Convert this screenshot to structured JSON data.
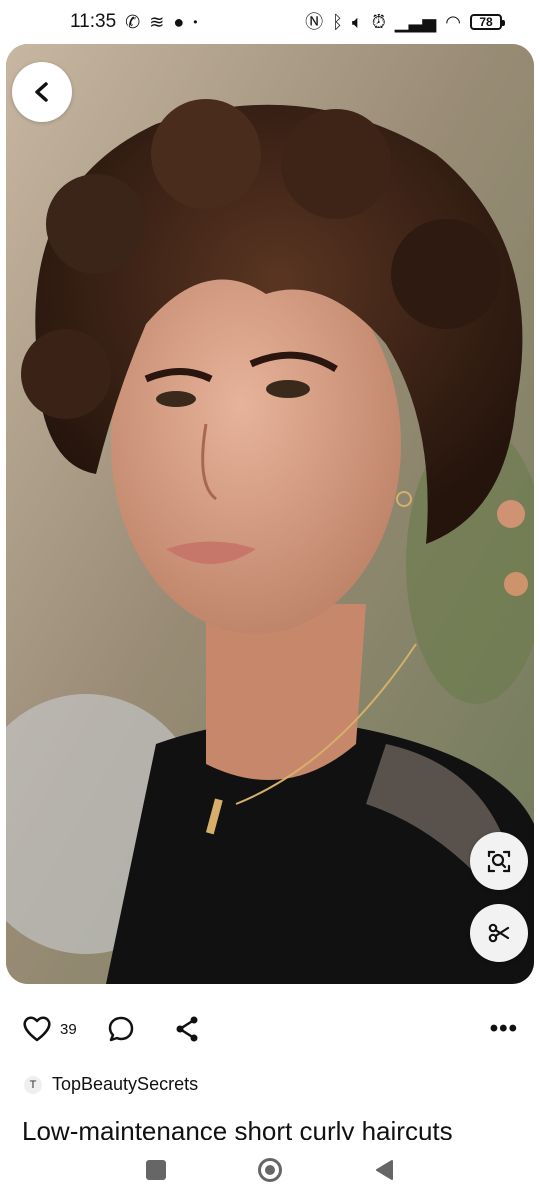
{
  "status_bar": {
    "time": "11:35",
    "battery": "78",
    "icons_left": [
      "phone-wifi-icon",
      "layers-icon",
      "planet-icon",
      "dot-icon"
    ],
    "icons_right": [
      "nfc-icon",
      "bluetooth-icon",
      "volume-icon",
      "alarm-icon",
      "signal-icon",
      "wifi-icon",
      "battery-icon"
    ]
  },
  "pin": {
    "image_subject": "portrait-photo",
    "likes": "39",
    "author_initial": "T",
    "author": "TopBeautySecrets",
    "title": "Low-maintenance short curly haircuts"
  },
  "actions": {
    "icons": [
      "back-icon",
      "visual-search-icon",
      "scissors-icon",
      "heart-icon",
      "comment-icon",
      "share-icon",
      "more-icon"
    ],
    "more_label": "•••"
  },
  "nav": {
    "icons": [
      "recents-icon",
      "home-icon",
      "back-nav-icon"
    ]
  }
}
